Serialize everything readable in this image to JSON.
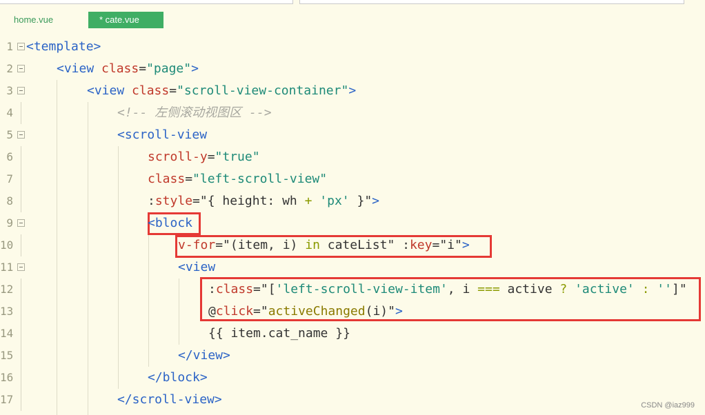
{
  "tabs": [
    {
      "label": "home.vue",
      "active": false
    },
    {
      "label": "* cate.vue",
      "active": true
    }
  ],
  "watermark": "CSDN @iaz999",
  "colors": {
    "background": "#fdfbe9",
    "active_tab": "#3fae64",
    "tag": "#2b63c6",
    "attribute": "#c0392b",
    "string": "#1e8a78",
    "comment": "#a8a8a0",
    "highlight_box": "#e53935"
  },
  "editor": {
    "lines": [
      {
        "no": "1",
        "fold": true,
        "segments": [
          [
            "t-tag",
            "<template>"
          ]
        ]
      },
      {
        "no": "2",
        "fold": true,
        "segments": [
          [
            "t-tag",
            "<view "
          ],
          [
            "t-attr",
            "class"
          ],
          [
            "t-txt",
            "="
          ],
          [
            "t-str",
            "\"page\""
          ],
          [
            "t-tag",
            ">"
          ]
        ]
      },
      {
        "no": "3",
        "fold": true,
        "segments": [
          [
            "t-tag",
            "<view "
          ],
          [
            "t-attr",
            "class"
          ],
          [
            "t-txt",
            "="
          ],
          [
            "t-str",
            "\"scroll-view-container\""
          ],
          [
            "t-tag",
            ">"
          ]
        ]
      },
      {
        "no": "4",
        "fold": false,
        "segments": [
          [
            "t-cmt",
            "<!-- 左侧滚动视图区 -->"
          ]
        ]
      },
      {
        "no": "5",
        "fold": true,
        "segments": [
          [
            "t-tag",
            "<scroll-view"
          ]
        ]
      },
      {
        "no": "6",
        "fold": false,
        "segments": [
          [
            "t-attr",
            "scroll-y"
          ],
          [
            "t-txt",
            "="
          ],
          [
            "t-str",
            "\"true\""
          ]
        ]
      },
      {
        "no": "7",
        "fold": false,
        "segments": [
          [
            "t-attr",
            "class"
          ],
          [
            "t-txt",
            "="
          ],
          [
            "t-str",
            "\"left-scroll-view\""
          ]
        ]
      },
      {
        "no": "8",
        "fold": false,
        "segments": [
          [
            "t-txt",
            ":"
          ],
          [
            "t-attr",
            "style"
          ],
          [
            "t-txt",
            "=\"{ height: wh "
          ],
          [
            "t-kw",
            "+"
          ],
          [
            "t-txt",
            " "
          ],
          [
            "t-str",
            "'px'"
          ],
          [
            "t-txt",
            " }\""
          ],
          [
            "t-tag",
            ">"
          ]
        ]
      },
      {
        "no": "9",
        "fold": true,
        "segments": [
          [
            "t-tag",
            "<block"
          ]
        ]
      },
      {
        "no": "10",
        "fold": false,
        "segments": [
          [
            "t-attr",
            "v-for"
          ],
          [
            "t-txt",
            "=\"(item, i) "
          ],
          [
            "t-kw",
            "in"
          ],
          [
            "t-txt",
            " cateList\" :"
          ],
          [
            "t-attr",
            "key"
          ],
          [
            "t-txt",
            "=\"i\""
          ],
          [
            "t-tag",
            ">"
          ]
        ]
      },
      {
        "no": "11",
        "fold": true,
        "segments": [
          [
            "t-tag",
            "<view"
          ]
        ]
      },
      {
        "no": "12",
        "fold": false,
        "segments": [
          [
            "t-txt",
            ":"
          ],
          [
            "t-attr",
            "class"
          ],
          [
            "t-txt",
            "=\"["
          ],
          [
            "t-str",
            "'left-scroll-view-item'"
          ],
          [
            "t-txt",
            ", i "
          ],
          [
            "t-kw",
            "==="
          ],
          [
            "t-txt",
            " active "
          ],
          [
            "t-kw",
            "?"
          ],
          [
            "t-txt",
            " "
          ],
          [
            "t-str",
            "'active'"
          ],
          [
            "t-txt",
            " "
          ],
          [
            "t-kw",
            ":"
          ],
          [
            "t-txt",
            " "
          ],
          [
            "t-str",
            "''"
          ],
          [
            "t-txt",
            "]\""
          ]
        ]
      },
      {
        "no": "13",
        "fold": false,
        "segments": [
          [
            "t-txt",
            "@"
          ],
          [
            "t-attr",
            "click"
          ],
          [
            "t-txt",
            "=\""
          ],
          [
            "t-fn",
            "activeChanged"
          ],
          [
            "t-txt",
            "(i)\""
          ],
          [
            "t-tag",
            ">"
          ]
        ]
      },
      {
        "no": "14",
        "fold": false,
        "segments": [
          [
            "t-txt",
            "{{ item.cat_name }}"
          ]
        ]
      },
      {
        "no": "15",
        "fold": false,
        "segments": [
          [
            "t-tag",
            "</view>"
          ]
        ]
      },
      {
        "no": "16",
        "fold": false,
        "segments": [
          [
            "t-tag",
            "</block>"
          ]
        ]
      },
      {
        "no": "17",
        "fold": false,
        "segments": [
          [
            "t-tag",
            "</scroll-view>"
          ]
        ]
      }
    ]
  }
}
